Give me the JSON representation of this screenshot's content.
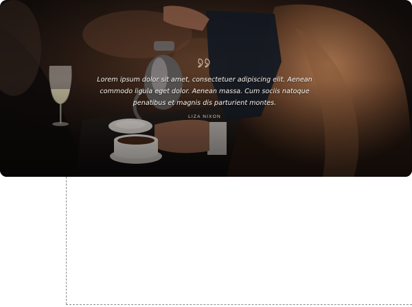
{
  "testimonial": {
    "quote": "Lorem ipsum dolor sit amet, consectetuer adipiscing elit. Aenean commodo ligula eget dolor. Aenean massa. Cum sociis natoque penatibus et magnis dis parturient montes.",
    "author": "LIZA NIXON",
    "quote_icon": "quote-mark-icon",
    "text_color": "#f6f1ec",
    "accent_color": "#c8b49f"
  },
  "drop_zone": {
    "border_color": "#8a8a8a",
    "border_style": "dashed"
  }
}
